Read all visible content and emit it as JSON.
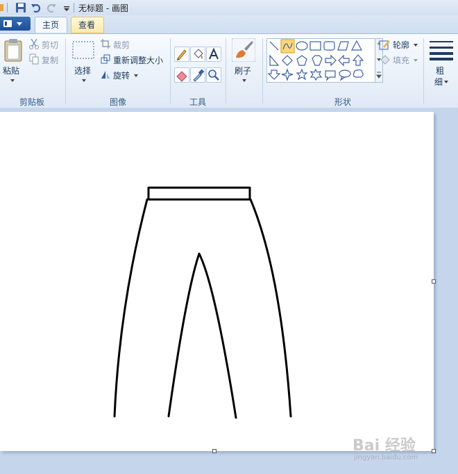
{
  "window": {
    "title": "无标题 - 画图"
  },
  "tabs": {
    "home": "主页",
    "view": "查看"
  },
  "clipboard": {
    "paste": "粘贴",
    "cut": "剪切",
    "copy": "复制",
    "group": "剪贴板"
  },
  "image": {
    "select": "选择",
    "crop": "裁剪",
    "resize": "重新调整大小",
    "rotate": "旋转",
    "group": "图像"
  },
  "tools": {
    "group": "工具"
  },
  "brushes": {
    "label": "刷子"
  },
  "shapes": {
    "outline": "轮廓",
    "fill": "填充",
    "group": "形状"
  },
  "size": {
    "label_1": "粗",
    "label_2": "细"
  },
  "watermark": {
    "main": "Bai 经验",
    "sub": "jingyan.baidu.com"
  }
}
